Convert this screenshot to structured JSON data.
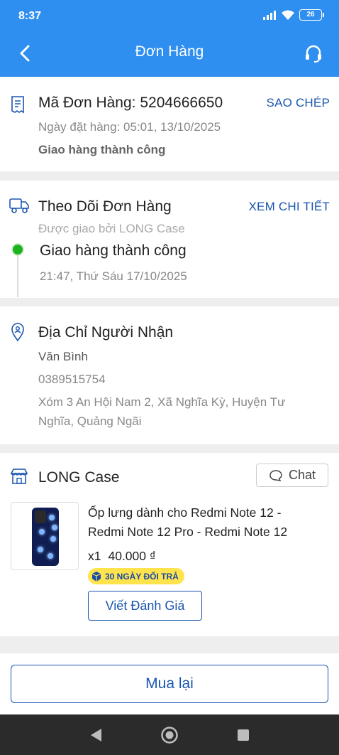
{
  "status_bar": {
    "time": "8:37",
    "battery": "26"
  },
  "header": {
    "title": "Đơn Hàng"
  },
  "order": {
    "code_label": "Mã Đơn Hàng: 5204666650",
    "copy_label": "SAO CHÉP",
    "date": "Ngày đặt hàng: 05:01, 13/10/2025",
    "status": "Giao hàng thành công"
  },
  "tracking": {
    "title": "Theo Dõi Đơn Hàng",
    "detail_link": "XEM CHI TIẾT",
    "carrier": "Được giao bởi LONG Case",
    "event_status": "Giao hàng thành công",
    "event_time": "21:47, Thứ Sáu 17/10/2025"
  },
  "address": {
    "title": "Địa Chỉ Người Nhận",
    "name": "Văn Bình",
    "phone": "0389515754",
    "line1": "Xóm 3 An Hội Nam 2, Xã Nghĩa Kỳ, Huyện Tư",
    "line2": "Nghĩa, Quảng Ngãi"
  },
  "shop": {
    "name": "LONG Case",
    "chat_label": "Chat"
  },
  "product": {
    "name_line1": "Ốp lưng dành cho Redmi Note 12 -",
    "name_line2": "Redmi Note 12 Pro - Redmi Note 12",
    "qty": "x1",
    "price": "40.000 ₫",
    "badge": "30 NGÀY ĐỔI TRẢ",
    "review_label": "Viết Đánh Giá"
  },
  "footer": {
    "buy_again_label": "Mua lại"
  },
  "colors": {
    "header": "#2f8ff0",
    "accent": "#1a56b0",
    "success": "#1db31d",
    "badge": "#ffe34d"
  },
  "icons": [
    "back-icon",
    "headset-icon",
    "receipt-icon",
    "truck-icon",
    "location-pin-icon",
    "store-icon",
    "chat-bubble-icon"
  ]
}
